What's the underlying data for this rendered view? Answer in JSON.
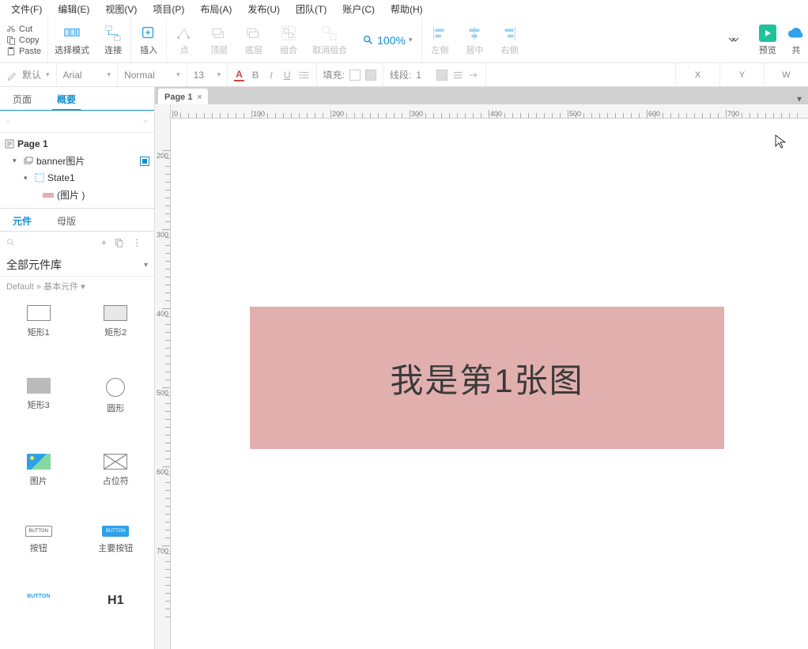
{
  "menu": [
    "文件(F)",
    "编辑(E)",
    "视图(V)",
    "项目(P)",
    "布局(A)",
    "发布(U)",
    "团队(T)",
    "账户(C)",
    "帮助(H)"
  ],
  "edit_small": {
    "cut": "Cut",
    "copy": "Copy",
    "paste": "Paste"
  },
  "tools": {
    "select": "选择模式",
    "connect": "连接",
    "insert": "插入",
    "point": "点",
    "top": "顶层",
    "bottom": "底层",
    "group": "组合",
    "ungroup": "取消组合",
    "left": "左侧",
    "center": "居中",
    "right": "右侧",
    "preview": "预览",
    "share": "共"
  },
  "zoom": "100%",
  "format": {
    "style": "默认",
    "font": "Arial",
    "weight": "Normal",
    "size": "13",
    "fill": "填充:",
    "line": "线段:",
    "lineVal": "1",
    "coords": [
      "X",
      "Y",
      "W"
    ]
  },
  "left_tabs": {
    "page": "页面",
    "outline": "概要"
  },
  "tree": {
    "page": "Page 1",
    "banner": "banner图片",
    "state": "State1",
    "image": "(图片 )"
  },
  "widget_tabs": {
    "widgets": "元件",
    "masters": "母版"
  },
  "library": "全部元件库",
  "crumb": "Default » 基本元件 ▾",
  "widgets": {
    "rect1": "矩形1",
    "rect2": "矩形2",
    "rect3": "矩形3",
    "circle": "圆形",
    "image": "图片",
    "placeholder": "占位符",
    "button": "按钮",
    "primary": "主要按钮",
    "link": "BUTTON",
    "h1": "H1"
  },
  "pagetab": "Page 1",
  "ruler_marks": [
    0,
    100,
    200,
    300,
    400,
    500,
    600,
    700
  ],
  "vruler_marks": [
    200,
    300,
    400,
    500,
    600,
    700
  ],
  "banner_text": "我是第1张图"
}
